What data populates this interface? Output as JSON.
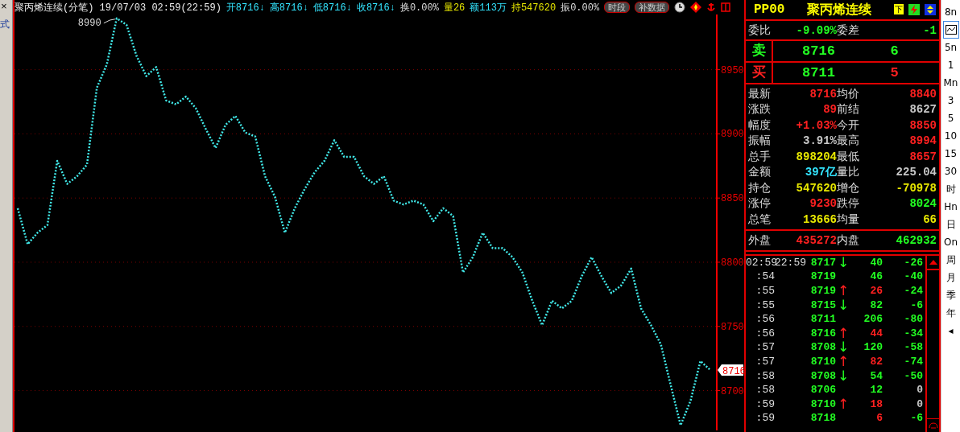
{
  "left_strip": {
    "close": "×",
    "label": "式"
  },
  "header": {
    "title": "聚丙烯连续(分笔) 19/07/03 02:59(22:59)",
    "stats": [
      {
        "text": "开8716↓",
        "color": "#33e5ff"
      },
      {
        "text": "高8716↓",
        "color": "#33e5ff"
      },
      {
        "text": "低8716↓",
        "color": "#33e5ff"
      },
      {
        "text": "收8716↓",
        "color": "#33e5ff"
      },
      {
        "text": "换0.00%",
        "color": "#dddddd"
      },
      {
        "text": "量26",
        "color": "#e8e800"
      },
      {
        "text": "额113万",
        "color": "#33e5ff"
      },
      {
        "text": "持547620",
        "color": "#e8e800"
      },
      {
        "text": "振0.00%",
        "color": "#dddddd"
      }
    ],
    "buttons": [
      "时段",
      "补数据"
    ]
  },
  "chart": {
    "peak_label": "8990",
    "last_price": "8716",
    "chart_data": {
      "type": "line",
      "ylim": [
        8669,
        8993
      ],
      "yticks": [
        8700,
        8750,
        8800,
        8850,
        8900,
        8950
      ],
      "grid": true,
      "series": [
        {
          "color": "#40e8e8",
          "line_style": "dashed",
          "values": [
            8842,
            8814,
            8823,
            8829,
            8879,
            8861,
            8867,
            8876,
            8936,
            8954,
            8990,
            8985,
            8961,
            8945,
            8952,
            8926,
            8923,
            8929,
            8920,
            8904,
            8889,
            8907,
            8914,
            8901,
            8898,
            8867,
            8851,
            8823,
            8842,
            8857,
            8870,
            8879,
            8895,
            8882,
            8882,
            8867,
            8861,
            8867,
            8848,
            8845,
            8848,
            8845,
            8832,
            8842,
            8836,
            8792,
            8804,
            8823,
            8811,
            8811,
            8804,
            8792,
            8770,
            8751,
            8770,
            8764,
            8770,
            8789,
            8804,
            8789,
            8776,
            8782,
            8795,
            8764,
            8751,
            8736,
            8704,
            8673,
            8692,
            8723,
            8716
          ]
        }
      ]
    }
  },
  "quote": {
    "code": "PP00",
    "name": "聚丙烯连续",
    "tools": [
      "下"
    ],
    "ratio": [
      {
        "label": "委比",
        "value": "-9.09%",
        "color": "#22ff22"
      },
      {
        "label": "委差",
        "value": "-1",
        "color": "#22ff22"
      }
    ],
    "book": [
      {
        "label": {
          "text": "卖",
          "color": "#22ff22"
        },
        "price": {
          "text": "8716",
          "color": "#22ff22"
        },
        "volume": {
          "text": "6",
          "color": "#22ff22"
        }
      },
      {
        "label": {
          "text": "买",
          "color": "#ff2020"
        },
        "price": {
          "text": "8711",
          "color": "#22ff22"
        },
        "volume": {
          "text": "5",
          "color": "#ff2020"
        }
      }
    ],
    "fields": [
      [
        {
          "label": "最新",
          "value": "8716",
          "color": "#ff2020"
        },
        {
          "label": "均价",
          "value": "8840",
          "color": "#ff2020"
        }
      ],
      [
        {
          "label": "涨跌",
          "value": "89",
          "color": "#ff2020"
        },
        {
          "label": "前结",
          "value": "8627",
          "color": "#c8c8c8"
        }
      ],
      [
        {
          "label": "幅度",
          "value": "+1.03%",
          "color": "#ff2020"
        },
        {
          "label": "今开",
          "value": "8850",
          "color": "#ff2020"
        }
      ],
      [
        {
          "label": "振幅",
          "value": "3.91%",
          "color": "#c8c8c8"
        },
        {
          "label": "最高",
          "value": "8994",
          "color": "#ff2020"
        }
      ],
      [
        {
          "label": "总手",
          "value": "898204",
          "color": "#e8e800"
        },
        {
          "label": "最低",
          "value": "8657",
          "color": "#ff2020"
        }
      ],
      [
        {
          "label": "金额",
          "value": "397亿",
          "color": "#33e5ff"
        },
        {
          "label": "量比",
          "value": "225.04",
          "color": "#c8c8c8"
        }
      ],
      [
        {
          "label": "持仓",
          "value": "547620",
          "color": "#e8e800"
        },
        {
          "label": "增仓",
          "value": "-70978",
          "color": "#e8e800"
        }
      ],
      [
        {
          "label": "涨停",
          "value": "9230",
          "color": "#ff2020"
        },
        {
          "label": "跌停",
          "value": "8024",
          "color": "#22ff22"
        }
      ],
      [
        {
          "label": "总笔",
          "value": "13666",
          "color": "#e8e800"
        },
        {
          "label": "均量",
          "value": "66",
          "color": "#e8e800"
        }
      ]
    ],
    "outer_inner": [
      {
        "label": "外盘",
        "value": "435272",
        "color": "#ff2020"
      },
      {
        "label": "内盘",
        "value": "462932",
        "color": "#22ff22"
      }
    ]
  },
  "ticks": [
    {
      "time": "02:59",
      "time2": "22:59",
      "price": "8717",
      "arrow": {
        "text": "↓",
        "color": "#22ff22"
      },
      "volume": {
        "text": "40",
        "color": "#22ff22"
      },
      "change": {
        "text": "-26",
        "color": "#22ff22"
      }
    },
    {
      "time": ":54",
      "price": "8719",
      "volume": {
        "text": "46",
        "color": "#22ff22"
      },
      "change": {
        "text": "-40",
        "color": "#22ff22"
      }
    },
    {
      "time": ":55",
      "price": "8719",
      "arrow": {
        "text": "↑",
        "color": "#ff2020"
      },
      "volume": {
        "text": "26",
        "color": "#ff2020"
      },
      "change": {
        "text": "-24",
        "color": "#22ff22"
      }
    },
    {
      "time": ":55",
      "price": "8715",
      "arrow": {
        "text": "↓",
        "color": "#22ff22"
      },
      "volume": {
        "text": "82",
        "color": "#22ff22"
      },
      "change": {
        "text": "-6",
        "color": "#22ff22"
      }
    },
    {
      "time": ":56",
      "price": "8711",
      "volume": {
        "text": "206",
        "color": "#22ff22"
      },
      "change": {
        "text": "-80",
        "color": "#22ff22"
      }
    },
    {
      "time": ":56",
      "price": "8716",
      "arrow": {
        "text": "↑",
        "color": "#ff2020"
      },
      "volume": {
        "text": "44",
        "color": "#ff2020"
      },
      "change": {
        "text": "-34",
        "color": "#22ff22"
      }
    },
    {
      "time": ":57",
      "price": "8708",
      "arrow": {
        "text": "↓",
        "color": "#22ff22"
      },
      "volume": {
        "text": "120",
        "color": "#22ff22"
      },
      "change": {
        "text": "-58",
        "color": "#22ff22"
      }
    },
    {
      "time": ":57",
      "price": "8710",
      "arrow": {
        "text": "↑",
        "color": "#ff2020"
      },
      "volume": {
        "text": "82",
        "color": "#ff2020"
      },
      "change": {
        "text": "-74",
        "color": "#22ff22"
      }
    },
    {
      "time": ":58",
      "price": "8708",
      "arrow": {
        "text": "↓",
        "color": "#22ff22"
      },
      "volume": {
        "text": "54",
        "color": "#22ff22"
      },
      "change": {
        "text": "-50",
        "color": "#22ff22"
      }
    },
    {
      "time": ":58",
      "price": "8706",
      "volume": {
        "text": "12",
        "color": "#22ff22"
      },
      "change": {
        "text": "0",
        "color": "#c8c8c8"
      }
    },
    {
      "time": ":59",
      "price": "8710",
      "arrow": {
        "text": "↑",
        "color": "#ff2020"
      },
      "volume": {
        "text": "18",
        "color": "#ff2020"
      },
      "change": {
        "text": "0",
        "color": "#c8c8c8"
      }
    },
    {
      "time": ":59",
      "price": "8718",
      "volume": {
        "text": "6",
        "color": "#ff2020"
      },
      "change": {
        "text": "-6",
        "color": "#22ff22"
      }
    }
  ],
  "periods": [
    {
      "kind": "text",
      "label": "8n",
      "selected": false
    },
    {
      "kind": "icon",
      "selected": true
    },
    {
      "kind": "text",
      "label": "5n",
      "selected": false
    },
    {
      "kind": "text",
      "label": "1",
      "selected": false
    },
    {
      "kind": "text",
      "label": "Mn",
      "selected": false
    },
    {
      "kind": "text",
      "label": "3",
      "selected": false
    },
    {
      "kind": "text",
      "label": "5",
      "selected": false
    },
    {
      "kind": "text",
      "label": "10",
      "selected": false
    },
    {
      "kind": "text",
      "label": "15",
      "selected": false
    },
    {
      "kind": "text",
      "label": "30",
      "selected": false
    },
    {
      "kind": "text",
      "label": "时",
      "selected": false
    },
    {
      "kind": "text",
      "label": "Hn",
      "selected": false
    },
    {
      "kind": "text",
      "label": "日",
      "selected": false
    },
    {
      "kind": "text",
      "label": "On",
      "selected": false
    },
    {
      "kind": "text",
      "label": "周",
      "selected": false
    },
    {
      "kind": "text",
      "label": "月",
      "selected": false
    },
    {
      "kind": "text",
      "label": "季",
      "selected": false
    },
    {
      "kind": "text",
      "label": "年",
      "selected": false
    },
    {
      "kind": "text",
      "label": "◂",
      "selected": false
    }
  ]
}
